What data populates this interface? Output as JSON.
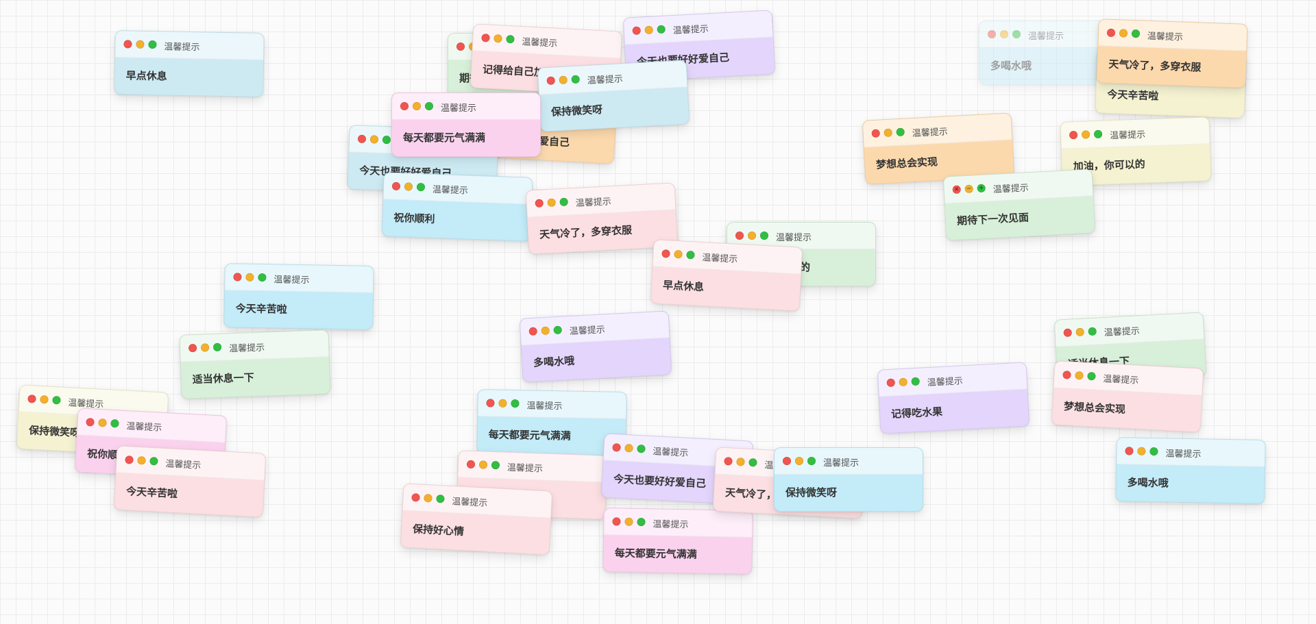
{
  "window_title": "温馨提示",
  "themes": {
    "blue": "#cdeaf3",
    "cyan": "#c3ebf8",
    "pink": "#fcdfe2",
    "magenta": "#fad2ee",
    "purple": "#e3d5fb",
    "green": "#d8f0d9",
    "orange": "#fcd9ad",
    "yellow": "#f5f2d2"
  },
  "cards": [
    {
      "message": "早点休息",
      "theme": "blue"
    },
    {
      "message": "期待下一次见面",
      "theme": "green"
    },
    {
      "message": "今天也要好好爱自己",
      "theme": "orange"
    },
    {
      "message": "记得给自己加油",
      "theme": "pink"
    },
    {
      "message": "今天也要好好爱自己",
      "theme": "purple"
    },
    {
      "message": "今天也要好好爱自己",
      "theme": "blue"
    },
    {
      "message": "保持微笑呀",
      "theme": "blue"
    },
    {
      "message": "每天都要元气满满",
      "theme": "magenta"
    },
    {
      "message": "祝你顺利",
      "theme": "cyan"
    },
    {
      "message": "天气冷了，多穿衣服",
      "theme": "pink"
    },
    {
      "message": "加油，你可以的",
      "theme": "green"
    },
    {
      "message": "早点休息",
      "theme": "pink"
    },
    {
      "message": "多喝水哦",
      "theme": "cyan"
    },
    {
      "message": "今天辛苦啦",
      "theme": "yellow"
    },
    {
      "message": "天气冷了，多穿衣服",
      "theme": "orange"
    },
    {
      "message": "梦想总会实现",
      "theme": "orange"
    },
    {
      "message": "加油，你可以的",
      "theme": "yellow"
    },
    {
      "message": "期待下一次见面",
      "theme": "green",
      "hovered": true
    },
    {
      "message": "今天辛苦啦",
      "theme": "cyan"
    },
    {
      "message": "适当休息一下",
      "theme": "green"
    },
    {
      "message": "多喝水哦",
      "theme": "purple"
    },
    {
      "message": "保持微笑呀",
      "theme": "yellow"
    },
    {
      "message": "祝你顺利",
      "theme": "magenta"
    },
    {
      "message": "今天辛苦啦",
      "theme": "pink"
    },
    {
      "message": "每天都要元气满满",
      "theme": "cyan"
    },
    {
      "message": "适当休息一下",
      "theme": "pink"
    },
    {
      "message": "保持好心情",
      "theme": "pink"
    },
    {
      "message": "今天也要好好爱自己",
      "theme": "purple"
    },
    {
      "message": "每天都要元气满满",
      "theme": "magenta"
    },
    {
      "message": "天气冷了，多穿衣服",
      "theme": "pink"
    },
    {
      "message": "保持微笑呀",
      "theme": "cyan"
    },
    {
      "message": "记得吃水果",
      "theme": "purple"
    },
    {
      "message": "适当休息一下",
      "theme": "green"
    },
    {
      "message": "梦想总会实现",
      "theme": "pink"
    },
    {
      "message": "多喝水哦",
      "theme": "cyan"
    }
  ]
}
